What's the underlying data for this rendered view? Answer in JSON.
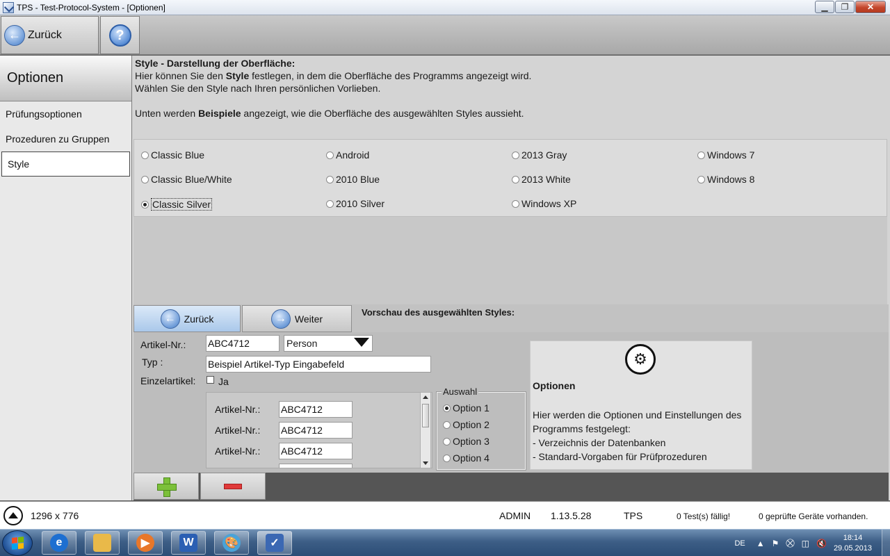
{
  "window": {
    "title": "TPS - Test-Protocol-System - [Optionen]",
    "controls": {
      "minimize": "▁",
      "maximize": "❐",
      "close": "✕"
    }
  },
  "toolbar": {
    "back_label": "Zurück",
    "help_label": "?"
  },
  "sidebar": {
    "header": "Optionen",
    "items": [
      {
        "label": "Prüfungsoptionen"
      },
      {
        "label": "Prozeduren zu Gruppen"
      },
      {
        "label": "Style",
        "active": true
      }
    ]
  },
  "intro": {
    "heading": "Style - Darstellung der Oberfläche:",
    "line1_pre": "Hier können Sie den ",
    "line1_bold": "Style",
    "line1_post": " festlegen, in dem die Oberfläche des Programms angezeigt wird.",
    "line2": "Wählen Sie den Style nach Ihren persönlichen Vorlieben.",
    "line3_pre": "Unten werden ",
    "line3_bold": "Beispiele",
    "line3_post": " angezeigt, wie die Oberfläche des ausgewählten Styles aussieht."
  },
  "styles": {
    "selected": "Classic Silver",
    "options": [
      "Classic Blue",
      "Android",
      "2013 Gray",
      "Windows 7",
      "Classic Blue/White",
      "2010 Blue",
      "2013 White",
      "Windows 8",
      "Classic Silver",
      "2010 Silver",
      "Windows XP"
    ]
  },
  "preview": {
    "back_label": "Zurück",
    "next_label": "Weiter",
    "title": "Vorschau des ausgewählten Styles:",
    "artikel_label": "Artikel-Nr.:",
    "artikel_value": "ABC4712",
    "person_select": "Person",
    "typ_label": "Typ :",
    "typ_value": "Beispiel Artikel-Typ Eingabefeld",
    "einzel_label": "Einzelartikel:",
    "einzel_check_label": "Ja",
    "list_rows": [
      {
        "label": "Artikel-Nr.:",
        "value": "ABC4712"
      },
      {
        "label": "Artikel-Nr.:",
        "value": "ABC4712"
      },
      {
        "label": "Artikel-Nr.:",
        "value": "ABC4712"
      }
    ],
    "auswahl": {
      "legend": "Auswahl",
      "options": [
        "Option 1",
        "Option 2",
        "Option 3",
        "Option 4"
      ],
      "selected": "Option 1"
    },
    "info": {
      "title": "Optionen",
      "line1": "Hier werden die Optionen und Einstellungen des",
      "line2": "Programms festgelegt:",
      "line3": "- Verzeichnis der Datenbanken",
      "line4": "- Standard-Vorgaben für Prüfprozeduren"
    }
  },
  "status": {
    "resolution": "1296 x 776",
    "user": "ADMIN",
    "version": "1.13.5.28",
    "app": "TPS",
    "tests_due": "0 Test(s) fällig!",
    "devices": "0 geprüfte Geräte vorhanden."
  },
  "taskbar": {
    "lang": "DE",
    "time": "18:14",
    "date": "29.05.2013",
    "colors": {
      "ie": "#1d6fd1",
      "explorer": "#e9b949",
      "media": "#e8772a",
      "word": "#2b5fb3",
      "paint": "#4aa3d8",
      "tps": "#3b68b3"
    }
  }
}
